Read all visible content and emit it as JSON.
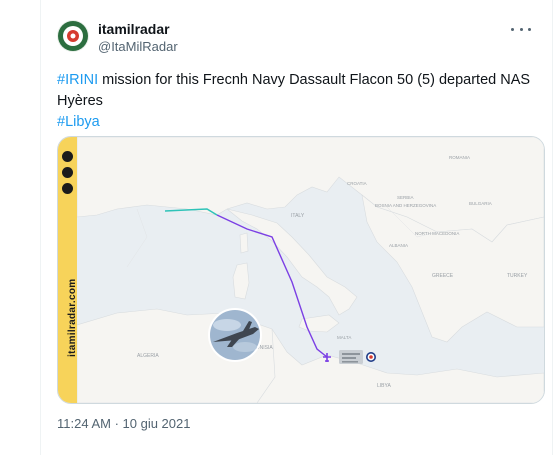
{
  "tweet": {
    "display_name": "itamilradar",
    "handle": "@ItaMilRadar",
    "text": {
      "hashtag1": "#IRINI",
      "body": " mission for this Frecnh Navy Dassault Flacon 50 (5) departed NAS Hyères",
      "hashtag2": "#Libya"
    },
    "timestamp": "11:24 AM · 10 giu 2021"
  },
  "media": {
    "watermark": "itamilradar.com",
    "map_labels": {
      "italy": "ITALY",
      "croatia": "CROATIA",
      "bosnia": "BOSNIA AND HERZEGOVINA",
      "serbia": "SERBIA",
      "romania": "ROMANIA",
      "bulgaria": "BULGARIA",
      "north_macedonia": "NORTH MACEDONIA",
      "albania": "ALBANIA",
      "greece": "GREECE",
      "tunisia": "TUNISIA",
      "libya": "LIBYA",
      "malta": "MALTA",
      "algeria": "ALGERIA",
      "turkey": "TURKEY"
    }
  },
  "colors": {
    "link": "#1d9bf0",
    "text": "#0f1419",
    "muted": "#536471",
    "track": "#7b3fe4",
    "watermark_bg": "#f7d35a"
  }
}
